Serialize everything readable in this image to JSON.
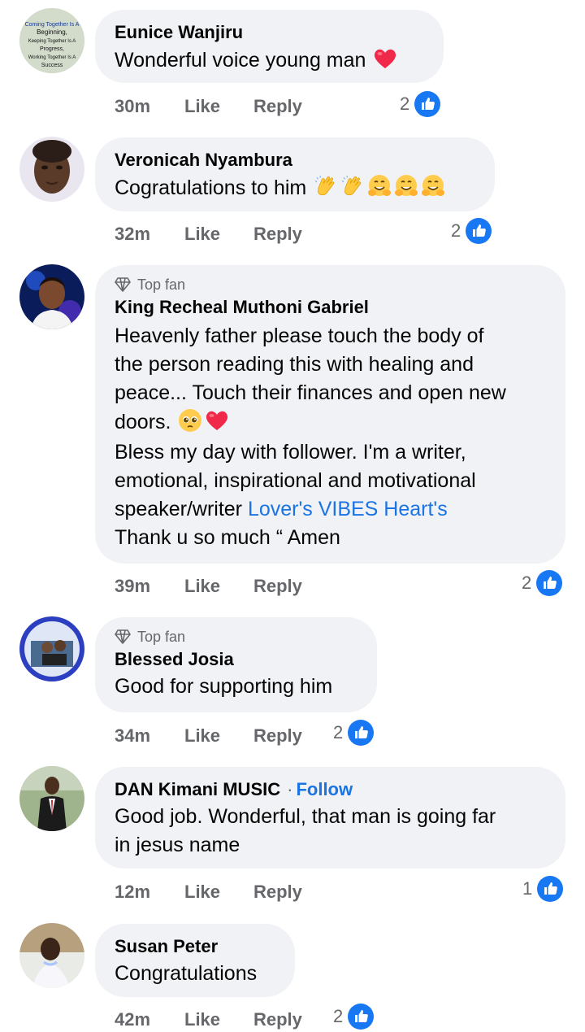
{
  "labels": {
    "like": "Like",
    "reply": "Reply",
    "top_fan": "Top fan",
    "follow": "Follow"
  },
  "colors": {
    "bubble": "#f0f2f5",
    "meta": "#65676b",
    "link": "#1b74e4",
    "like_blue": "#1877f2",
    "heart": "#f02849"
  },
  "comments": [
    {
      "name": "Eunice Wanjiru",
      "lines": [
        "Wonderful voice young man"
      ],
      "time": "30m",
      "reactions": "2",
      "avatar_text": [
        "Coming Together Is A",
        "Beginning,",
        "Keeping Together Is A",
        "Progress,",
        "Working Together Is A",
        "Success"
      ]
    },
    {
      "name": "Veronicah Nyambura",
      "lines": [
        "Cogratulations to him"
      ],
      "time": "32m",
      "reactions": "2"
    },
    {
      "name": "King Recheal Muthoni Gabriel",
      "top_fan": true,
      "lines": [
        "Heavenly father please touch the body of",
        "the person reading this with healing and",
        "peace... Touch their finances and open new",
        "doors.",
        "Bless my day with follower. I'm a writer,",
        "emotional, inspirational and motivational",
        "speaker/writer ",
        "Thank u so much “ Amen"
      ],
      "link": "Lover's VIBES Heart's",
      "time": "39m",
      "reactions": "2"
    },
    {
      "name": "Blessed Josia",
      "top_fan": true,
      "lines": [
        "Good for supporting him"
      ],
      "time": "34m",
      "reactions": "2"
    },
    {
      "name": "DAN Kimani MUSIC",
      "follow": true,
      "follow_dot": "·",
      "lines": [
        "Good job. Wonderful, that man is going far",
        "in jesus name"
      ],
      "time": "12m",
      "reactions": "1"
    },
    {
      "name": "Susan Peter",
      "lines": [
        "Congratulations"
      ],
      "time": "42m",
      "reactions": "2"
    }
  ],
  "icons": {
    "like": "thumbs-up-icon",
    "heart": "red-heart-icon",
    "clap": "clapping-hands-icon",
    "hug": "hugging-face-icon",
    "pleading": "pleading-face-icon",
    "diamond": "diamond-icon"
  }
}
